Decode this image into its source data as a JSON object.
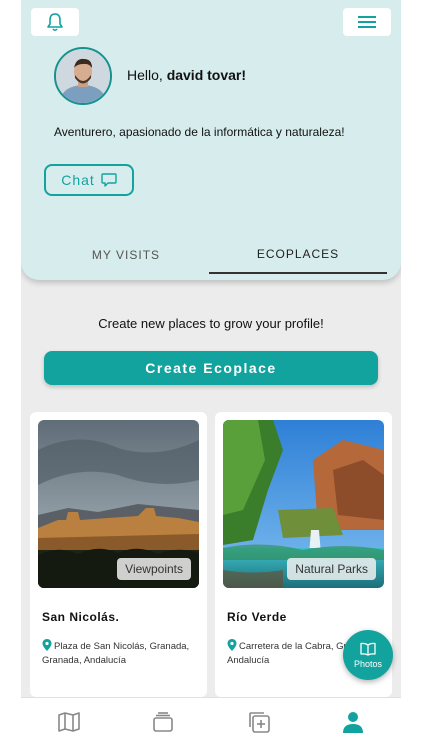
{
  "header": {
    "greeting_prefix": "Hello,",
    "user_name": "david tovar!",
    "bio": "Aventurero, apasionado de la informática y naturaleza!",
    "chat_label": "Chat"
  },
  "tabs": [
    {
      "label": "MY VISITS",
      "active": false
    },
    {
      "label": "ECOPLACES",
      "active": true
    }
  ],
  "main": {
    "prompt": "Create new places to grow your profile!",
    "create_label": "Create Ecoplace"
  },
  "cards": [
    {
      "title": "San Nicolás.",
      "category": "Viewpoints",
      "location": "Plaza de San Nicolás, Granada, Granada, Andalucía"
    },
    {
      "title": "Río Verde",
      "category": "Natural Parks",
      "location": "Carretera de la Cabra, Granada, Andalucía"
    }
  ],
  "fab": {
    "label": "Photos",
    "icon": "book-icon"
  },
  "bottom_nav": [
    {
      "icon": "map-icon",
      "active": false
    },
    {
      "icon": "stack-icon",
      "active": false
    },
    {
      "icon": "add-square-icon",
      "active": false
    },
    {
      "icon": "user-icon",
      "active": true
    }
  ],
  "colors": {
    "accent": "#13a39e",
    "header_bg": "#d7ecec",
    "page_bg": "#ececec"
  }
}
